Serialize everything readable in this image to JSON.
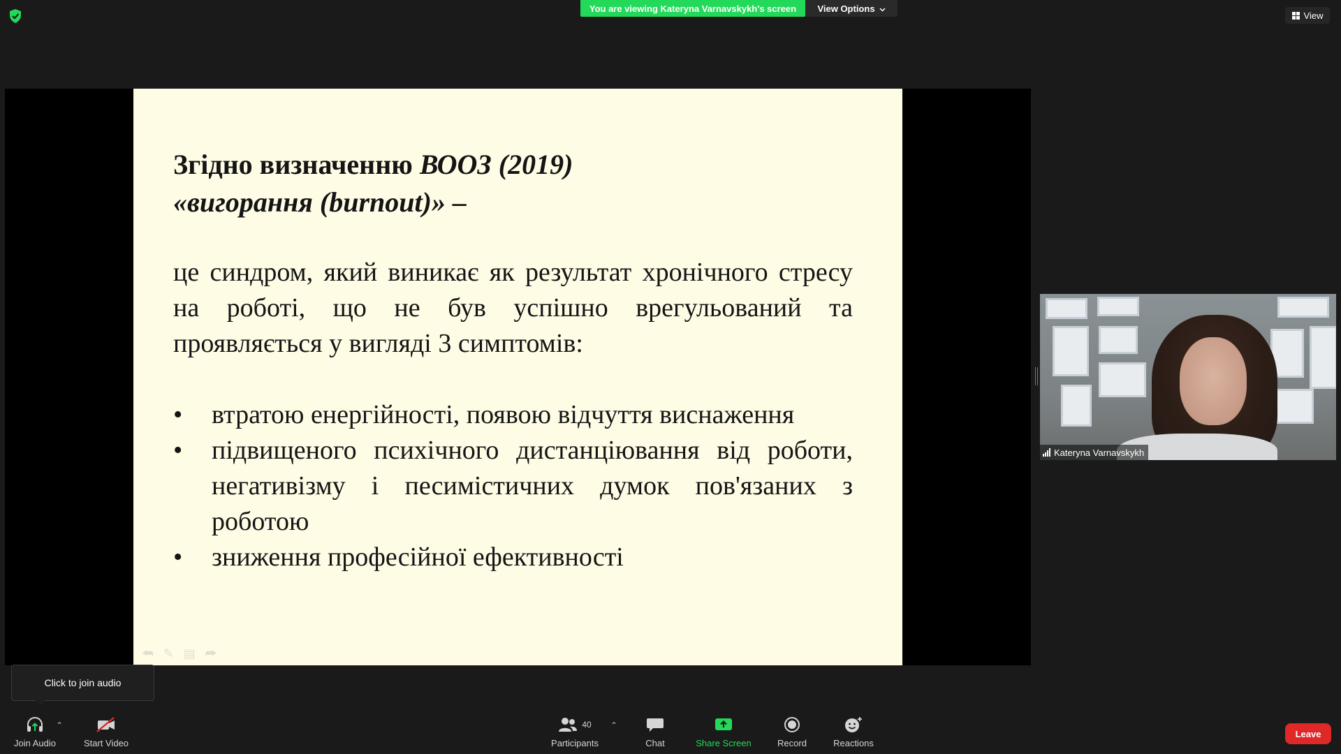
{
  "top_bar": {
    "banner_text": "You are viewing Kateryna Varnavskykh's screen",
    "view_options_label": "View Options",
    "view_label": "View"
  },
  "slide": {
    "title_line1_normal": "Згідно визначенню ",
    "title_line1_italic": "ВООЗ (2019)",
    "title_line2": "«вигорання (burnout)» –",
    "body": "це синдром, який виникає як результат хронічного стресу на роботі, що не був успішно врегульований та проявляється у вигляді 3 симптомів:",
    "bullets": [
      "втратою енергійності, появою відчуття виснаження",
      "підвищеного психічного дистанціювання від роботи, негативізму і песимістичних думок пов'язаних з роботою",
      "зниження професійної ефективності"
    ]
  },
  "participant_video": {
    "name": "Kateryna Varnavskykh"
  },
  "tooltip": {
    "text": "Click to join audio"
  },
  "toolbar": {
    "join_audio": "Join Audio",
    "start_video": "Start Video",
    "participants": "Participants",
    "participants_count": "40",
    "chat": "Chat",
    "share_screen": "Share Screen",
    "record": "Record",
    "reactions": "Reactions",
    "leave": "Leave"
  },
  "colors": {
    "share_green": "#23d959",
    "leave_red": "#e02828",
    "slide_bg": "#fffce6"
  }
}
